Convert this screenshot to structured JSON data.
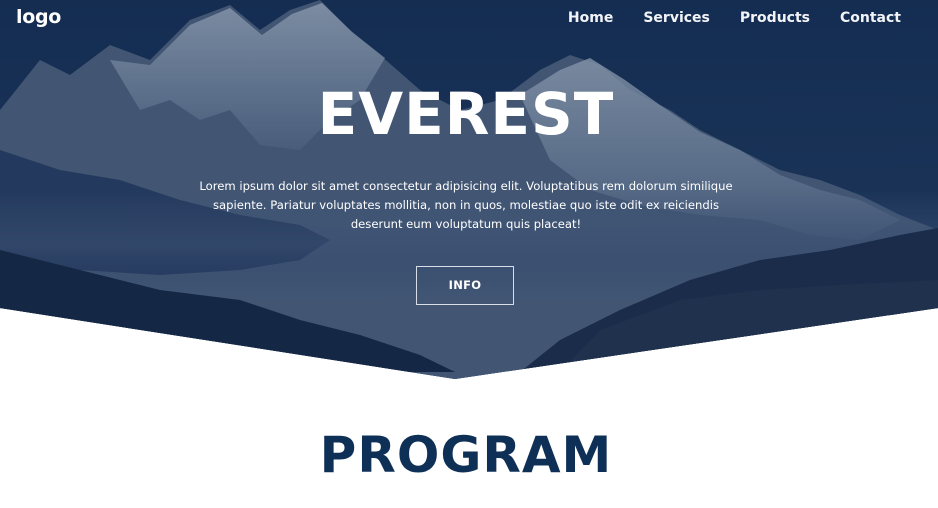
{
  "nav": {
    "logo": "logo",
    "links": [
      "Home",
      "Services",
      "Products",
      "Contact"
    ]
  },
  "hero": {
    "title": "EVEREST",
    "text": "Lorem ipsum dolor sit amet consectetur adipisicing elit. Voluptatibus rem dolorum similique sapiente. Pariatur voluptates mollitia, non in quos, molestiae quo iste odit ex reiciendis deserunt eum voluptatum quis placeat!",
    "button_label": "INFO"
  },
  "section": {
    "title": "PROGRAM"
  },
  "colors": {
    "hero_overlay": "#1c3356",
    "section_title": "#0f3056",
    "text_light": "#ffffff"
  }
}
